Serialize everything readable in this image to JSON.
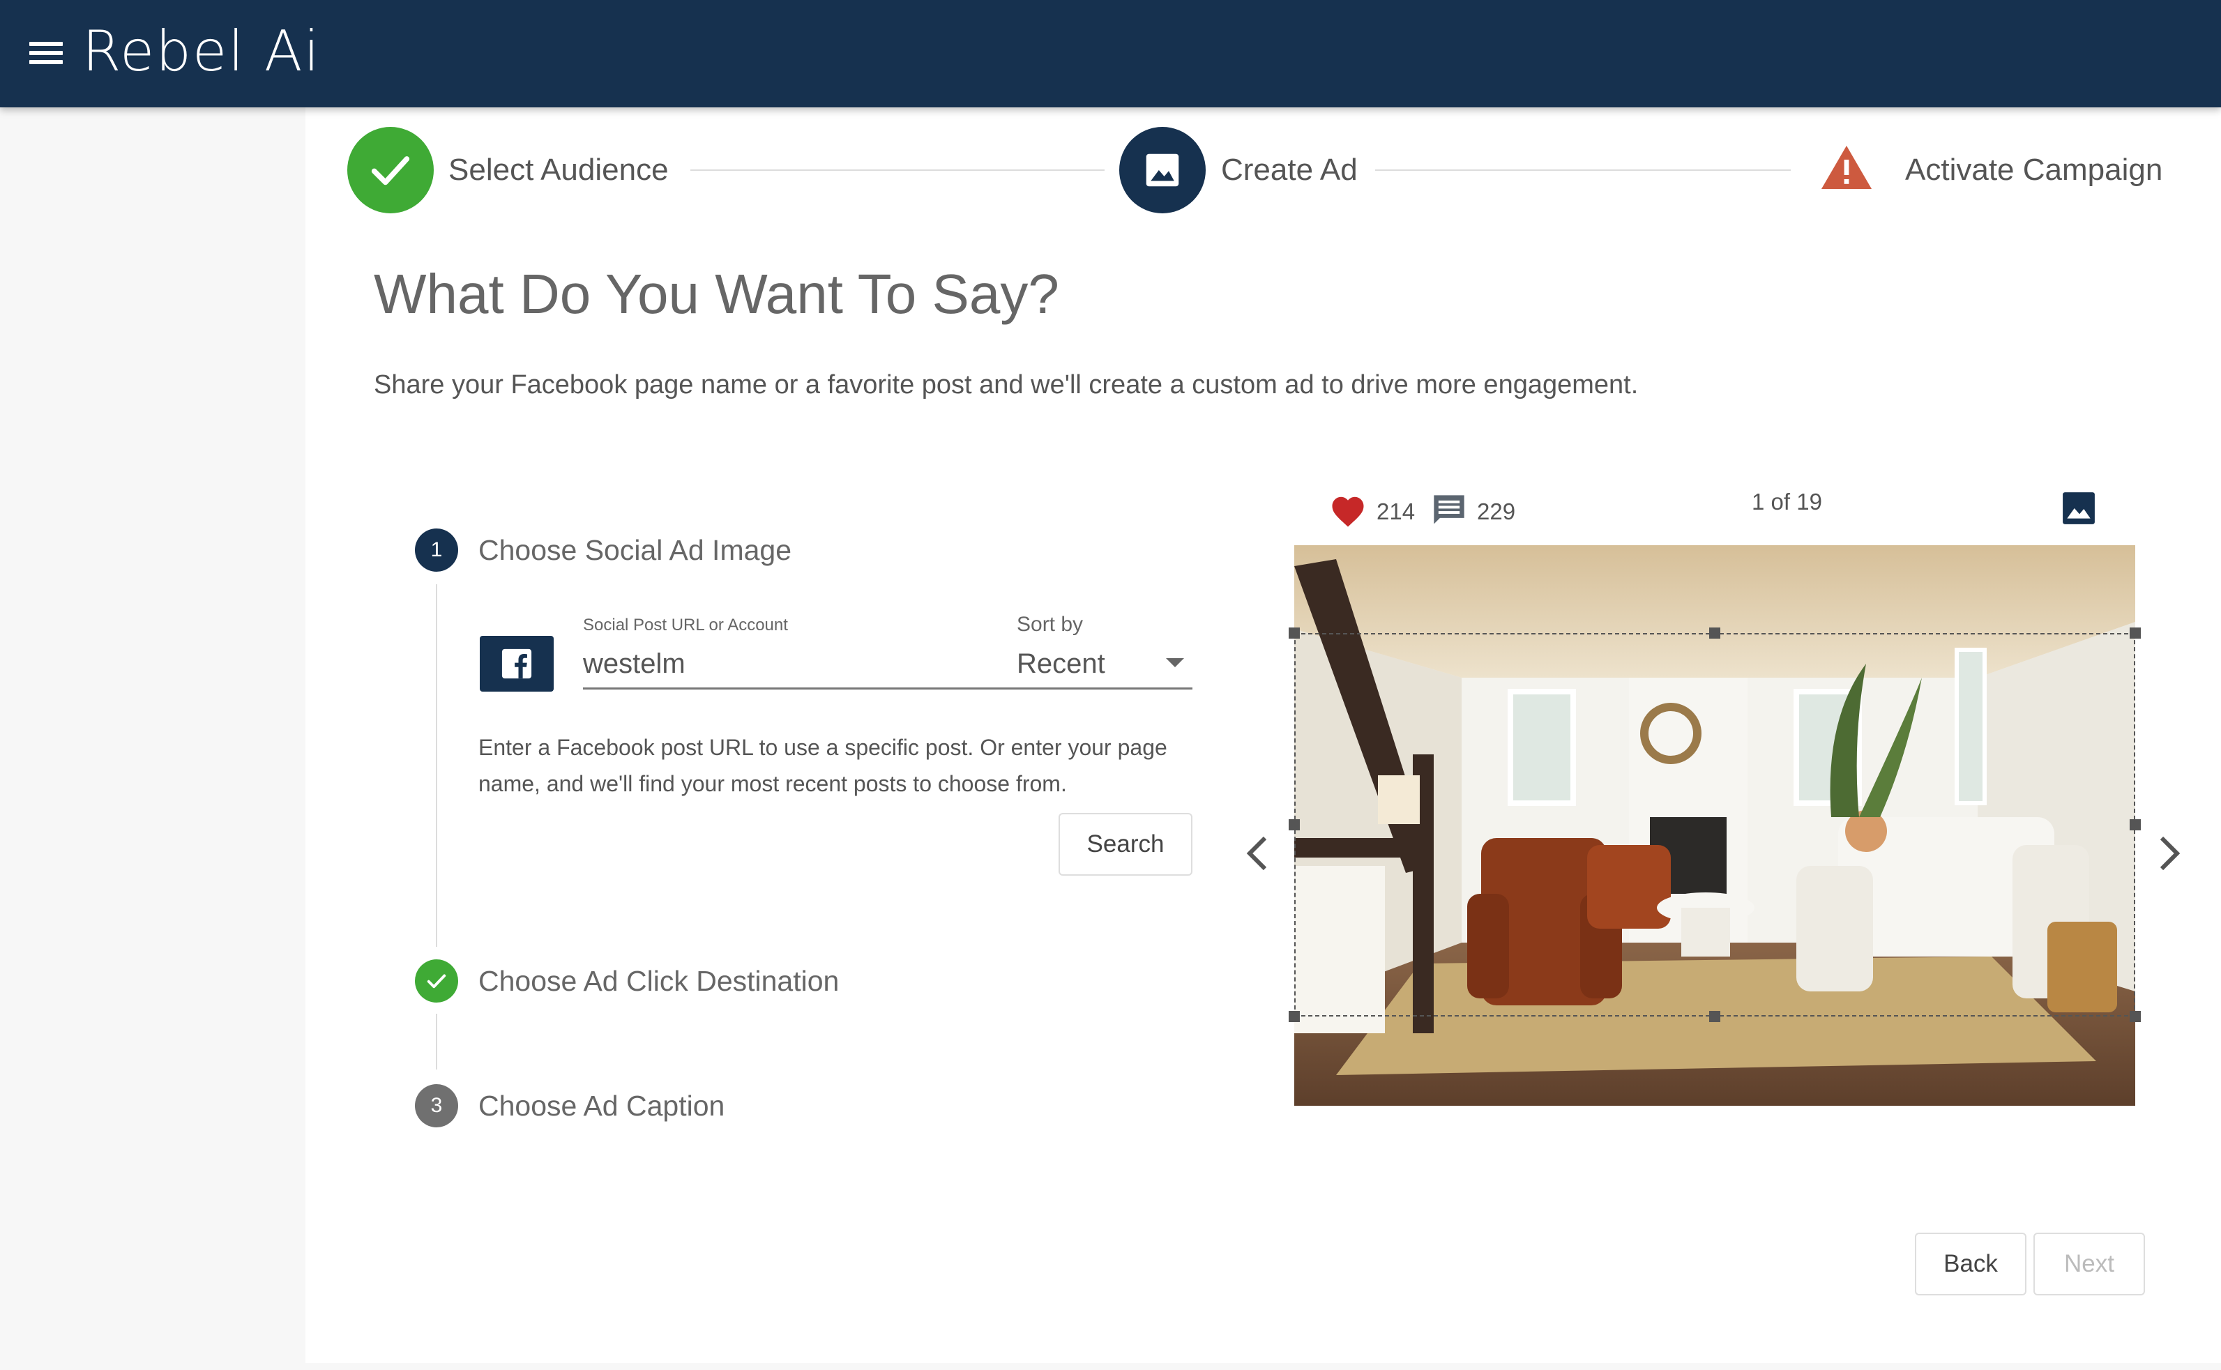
{
  "header": {
    "logo": "Rebel Ai"
  },
  "stepper": {
    "steps": [
      {
        "label": "Select Audience",
        "state": "complete"
      },
      {
        "label": "Create Ad",
        "state": "active"
      },
      {
        "label": "Activate Campaign",
        "state": "warning"
      }
    ]
  },
  "page": {
    "title": "What Do You Want To Say?",
    "subtitle": "Share your Facebook page name or a favorite post and we'll create a custom ad to drive more engagement."
  },
  "substeps": [
    {
      "number": "1",
      "title": "Choose Social Ad Image",
      "state": "active"
    },
    {
      "number": "",
      "title": "Choose Ad Click Destination",
      "state": "complete"
    },
    {
      "number": "3",
      "title": "Choose Ad Caption",
      "state": "pending"
    }
  ],
  "form": {
    "url_label": "Social Post URL or Account",
    "url_value": "westelm",
    "sort_label": "Sort by",
    "sort_value": "Recent",
    "help_text": "Enter a Facebook post URL to use a specific post. Or enter your page name, and we'll find your most recent posts to choose from.",
    "search_label": "Search"
  },
  "post": {
    "likes": "214",
    "comments": "229",
    "pager": "1 of 19"
  },
  "footer": {
    "back_label": "Back",
    "next_label": "Next"
  },
  "colors": {
    "header": "#16314f",
    "success": "#3faa35",
    "warning": "#cd5a3f",
    "heart": "#c62828",
    "pending": "#707070"
  },
  "icons": {
    "menu": "hamburger-menu-icon",
    "check": "check-icon",
    "image": "image-icon",
    "warning": "warning-icon",
    "facebook": "facebook-icon",
    "heart": "heart-icon",
    "comment": "comment-icon",
    "prev": "chevron-left-icon",
    "next": "chevron-right-icon"
  }
}
